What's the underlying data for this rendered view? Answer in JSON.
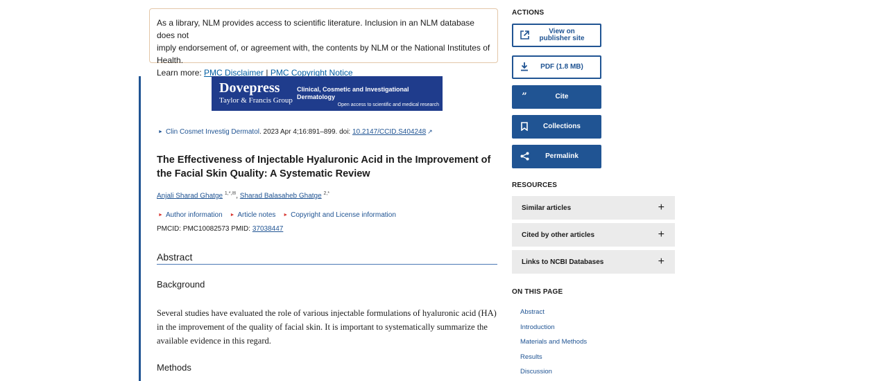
{
  "disclaimer": {
    "line1": "As a library, NLM provides access to scientific literature. Inclusion in an NLM database does not",
    "line2": "imply endorsement of, or agreement with, the contents by NLM or the National Institutes of Health.",
    "learn_more": "Learn more: ",
    "link1": "PMC Disclaimer",
    "separator": " | ",
    "link2": "PMC Copyright Notice"
  },
  "banner": {
    "brand": "Dovepress",
    "brand_sub": "Taylor & Francis Group",
    "journal": "Clinical, Cosmetic and Investigational Dermatology",
    "open_access": "Open access to scientific and medical research"
  },
  "citation": {
    "journal": "Clin Cosmet Investig Dermatol",
    "details": ". 2023 Apr 4;16:891–899. doi: ",
    "doi": "10.2147/CCID.S404248"
  },
  "article": {
    "title": "The Effectiveness of Injectable Hyaluronic Acid in the Improvement of the Facial Skin Quality: A Systematic Review",
    "authors": [
      {
        "name": "Anjali Sharad Ghatge",
        "sup": "1,*,✉"
      },
      {
        "name": "Sharad Balasaheb Ghatge",
        "sup": "2,*"
      }
    ],
    "author_sep": ", ",
    "meta_links": [
      "Author information",
      "Article notes",
      "Copyright and License information"
    ],
    "pmcid_label": "PMCID: PMC10082573  PMID: ",
    "pmid": "37038447",
    "abstract_heading": "Abstract",
    "background_heading": "Background",
    "background_text": "Several studies have evaluated the role of various injectable formulations of hyaluronic acid (HA) in the improvement of the quality of facial skin. It is important to systematically summarize the available evidence in this regard.",
    "methods_heading": "Methods"
  },
  "sidebar": {
    "actions_heading": "ACTIONS",
    "actions": [
      {
        "label": "View on publisher site",
        "icon": "external-link-icon"
      },
      {
        "label": "PDF (1.8 MB)",
        "icon": "download-icon"
      },
      {
        "label": "Cite",
        "icon": "quote-icon"
      },
      {
        "label": "Collections",
        "icon": "bookmark-icon"
      },
      {
        "label": "Permalink",
        "icon": "share-icon"
      }
    ],
    "resources_heading": "RESOURCES",
    "resources": [
      "Similar articles",
      "Cited by other articles",
      "Links to NCBI Databases"
    ],
    "on_this_page_heading": "ON THIS PAGE",
    "toc": [
      "Abstract",
      "Introduction",
      "Materials and Methods",
      "Results",
      "Discussion"
    ]
  },
  "colors": {
    "primary": "#205493",
    "banner": "#1f3c8c",
    "resource_bg": "#ebebeb",
    "disclaimer_border": "#e3c7a8"
  }
}
